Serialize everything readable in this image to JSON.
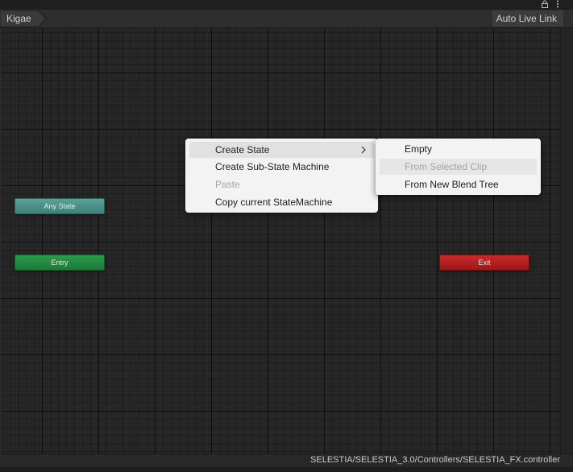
{
  "toolbar": {
    "breadcrumb": "Kigae",
    "auto_live_link": "Auto Live Link"
  },
  "nodes": {
    "any_state": "Any State",
    "entry": "Entry",
    "exit": "Exit"
  },
  "context_menu": {
    "items": [
      {
        "label": "Create State",
        "has_submenu": true,
        "highlighted": true
      },
      {
        "label": "Create Sub-State Machine"
      },
      {
        "label": "Paste",
        "disabled": true
      },
      {
        "label": "Copy current StateMachine"
      }
    ]
  },
  "submenu": {
    "items": [
      {
        "label": "Empty"
      },
      {
        "label": "From Selected Clip",
        "disabled": true
      },
      {
        "label": "From New Blend Tree"
      }
    ]
  },
  "footer": {
    "path": "SELESTIA/SELESTIA_3.0/Controllers/SELESTIA_FX.controller"
  },
  "icons": {
    "lock": "lock-icon",
    "menu": "kebab-menu-icon",
    "submenu_arrow": "chevron-right-icon"
  },
  "colors": {
    "any_state": "#4a9188",
    "entry": "#22873f",
    "exit": "#b51f1f",
    "menu_bg": "#f3f3f3"
  }
}
